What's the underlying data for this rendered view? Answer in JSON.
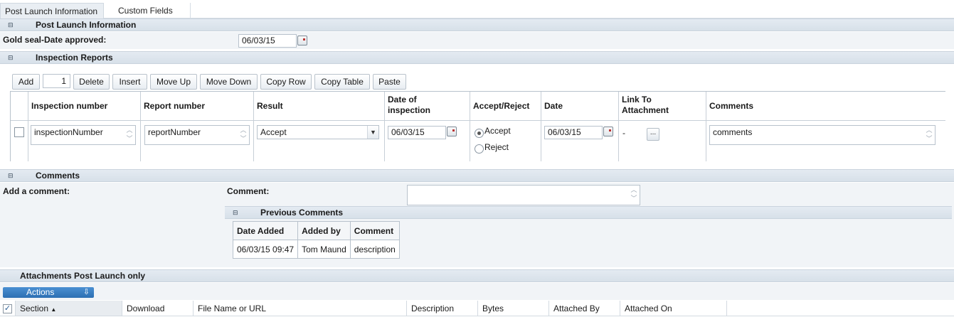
{
  "tabs": [
    "Post Launch Information",
    "Custom Fields"
  ],
  "post_launch": {
    "title": "Post Launch Information",
    "gold_seal_label": "Gold seal-Date approved:",
    "gold_seal_value": "06/03/15"
  },
  "inspection": {
    "title": "Inspection Reports",
    "toolbar": {
      "add": "Add",
      "count": "1",
      "delete": "Delete",
      "insert": "Insert",
      "move_up": "Move Up",
      "move_down": "Move Down",
      "copy_row": "Copy Row",
      "copy_table": "Copy Table",
      "paste": "Paste"
    },
    "columns": {
      "inspection_number": "Inspection number",
      "report_number": "Report number",
      "result": "Result",
      "date_of_inspection_1": "Date of",
      "date_of_inspection_2": "inspection",
      "accept_reject": "Accept/Reject",
      "date": "Date",
      "link_1": "Link To",
      "link_2": "Attachment",
      "comments": "Comments"
    },
    "row": {
      "inspection_number": "inspectionNumber",
      "report_number": "reportNumber",
      "result": "Accept",
      "date_of_inspection": "06/03/15",
      "accept_label": "Accept",
      "reject_label": "Reject",
      "date": "06/03/15",
      "link": "-",
      "link_button": "...",
      "comments": "comments"
    }
  },
  "comments": {
    "title": "Comments",
    "add_label": "Add a comment:",
    "comment_label": "Comment:",
    "comment_value": "",
    "previous": {
      "title": "Previous Comments",
      "headers": [
        "Date Added",
        "Added by",
        "Comment"
      ],
      "rows": [
        [
          "06/03/15 09:47",
          "Tom Maund",
          "description"
        ]
      ]
    }
  },
  "attachments": {
    "title": "Attachments Post Launch only",
    "actions_label": "Actions",
    "columns": [
      "Section",
      "Download",
      "File Name or URL",
      "Description",
      "Bytes",
      "Attached By",
      "Attached On"
    ],
    "sort_indicator": "▲"
  }
}
